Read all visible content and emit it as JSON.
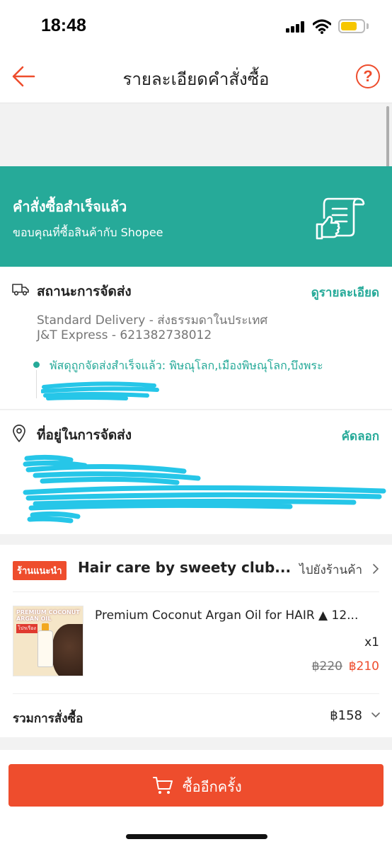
{
  "status_bar": {
    "time": "18:48"
  },
  "header": {
    "title": "รายละเอียดคำสั่งซื้อ",
    "help_label": "?"
  },
  "banner": {
    "title": "คำสั่งซื้อสำเร็จแล้ว",
    "subtitle": "ขอบคุณที่ซื้อสินค้ากับ Shopee",
    "background_color": "#26aa99"
  },
  "shipping": {
    "title": "สถานะการจัดส่ง",
    "link": "ดูรายละเอียด",
    "method": "Standard Delivery - ส่งธรรมดาในประเทศ",
    "carrier_tracking": "J&T Express - 621382738012",
    "latest_status": "พัสดุถูกจัดส่งสำเร็จแล้ว: พิษณุโลก,เมืองพิษณุโลก,บึงพระ"
  },
  "address": {
    "title": "ที่อยู่ในการจัดส่ง",
    "copy_label": "คัดลอก"
  },
  "shop": {
    "badge": "ร้านแนะนำ",
    "name": "Hair care by sweety club...",
    "go_to_shop": "ไปยังร้านค้า",
    "product": {
      "name": "Premium Coconut Argan Oil for HAIR ▲ 12...",
      "quantity": "x1",
      "original_price": "฿220",
      "price": "฿210",
      "thumb_brand_line1": "PREMIUM COCONUT",
      "thumb_brand_line2": "ARGAN OIL",
      "thumb_tag": "โปรเรือง"
    },
    "order_total_label": "รวมการสั่งซื้อ",
    "order_total_value": "฿158"
  },
  "footer": {
    "buy_again_label": "ซื้ออีกครั้ง",
    "accent_color": "#ee4d2d"
  }
}
